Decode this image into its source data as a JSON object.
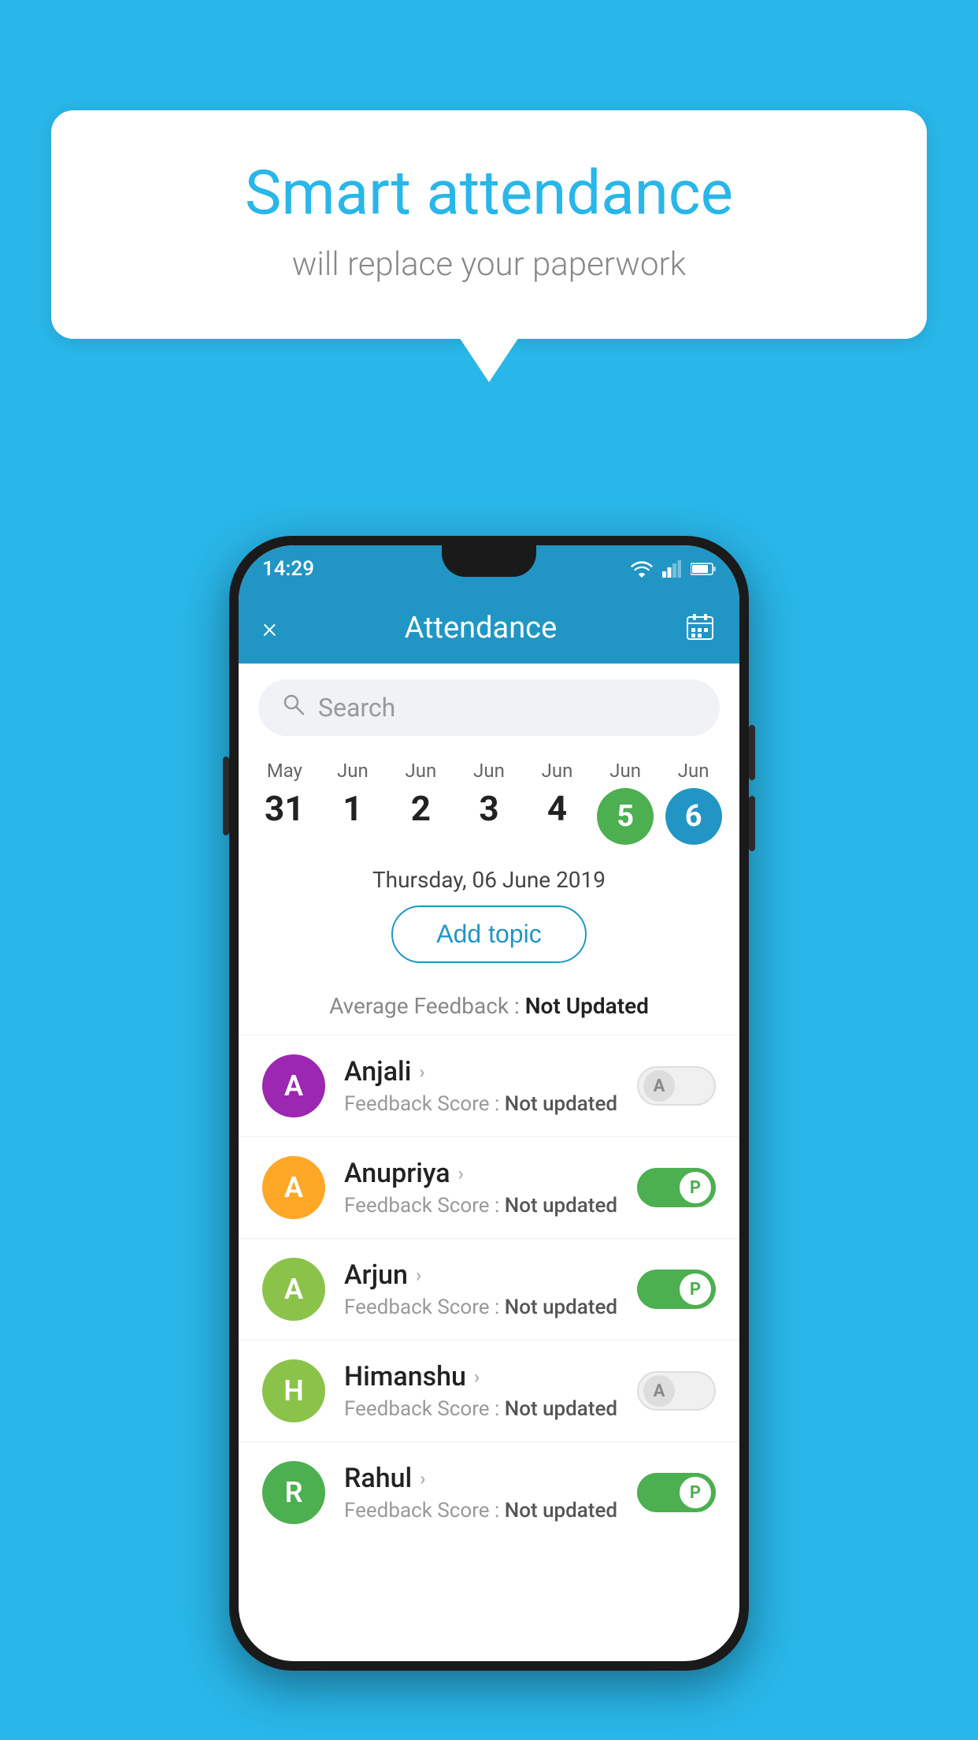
{
  "background_color": "#29b6e8",
  "speech_bubble": {
    "title": "Smart attendance",
    "subtitle": "will replace your paperwork"
  },
  "status_bar": {
    "time": "14:29"
  },
  "app_header": {
    "title": "Attendance",
    "close_icon": "×",
    "calendar_icon": "📅"
  },
  "search": {
    "placeholder": "Search"
  },
  "date_strip": [
    {
      "month": "May",
      "day": "31",
      "active": false
    },
    {
      "month": "Jun",
      "day": "1",
      "active": false
    },
    {
      "month": "Jun",
      "day": "2",
      "active": false
    },
    {
      "month": "Jun",
      "day": "3",
      "active": false
    },
    {
      "month": "Jun",
      "day": "4",
      "active": false
    },
    {
      "month": "Jun",
      "day": "5",
      "active": "green"
    },
    {
      "month": "Jun",
      "day": "6",
      "active": "blue"
    }
  ],
  "selected_date": "Thursday, 06 June 2019",
  "add_topic_label": "Add topic",
  "avg_feedback_label": "Average Feedback :",
  "avg_feedback_value": "Not Updated",
  "students": [
    {
      "name": "Anjali",
      "initial": "A",
      "avatar_color": "#9c27b0",
      "feedback_label": "Feedback Score :",
      "feedback_value": "Not updated",
      "toggle": "off",
      "toggle_letter": "A"
    },
    {
      "name": "Anupriya",
      "initial": "A",
      "avatar_color": "#ffa726",
      "feedback_label": "Feedback Score :",
      "feedback_value": "Not updated",
      "toggle": "on",
      "toggle_letter": "P"
    },
    {
      "name": "Arjun",
      "initial": "A",
      "avatar_color": "#8bc34a",
      "feedback_label": "Feedback Score :",
      "feedback_value": "Not updated",
      "toggle": "on",
      "toggle_letter": "P"
    },
    {
      "name": "Himanshu",
      "initial": "H",
      "avatar_color": "#8bc34a",
      "feedback_label": "Feedback Score :",
      "feedback_value": "Not updated",
      "toggle": "off",
      "toggle_letter": "A"
    },
    {
      "name": "Rahul",
      "initial": "R",
      "avatar_color": "#4caf50",
      "feedback_label": "Feedback Score :",
      "feedback_value": "Not updated",
      "toggle": "on",
      "toggle_letter": "P"
    }
  ]
}
